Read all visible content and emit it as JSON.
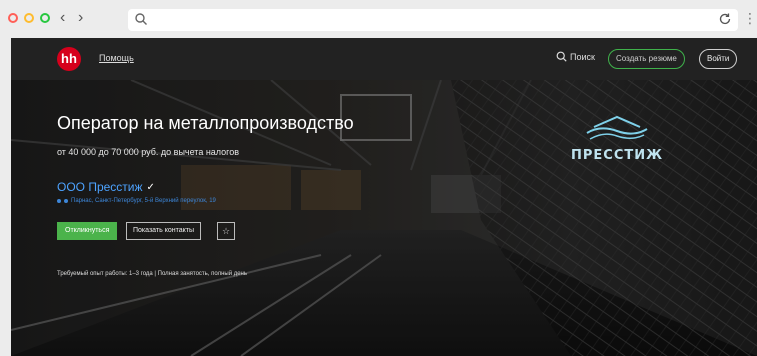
{
  "browser": {
    "address_value": "",
    "icons": [
      "search-icon",
      "reload-icon",
      "back-icon",
      "forward-icon"
    ]
  },
  "header": {
    "logo_text": "hh",
    "help_link": "Помощь",
    "search_label": "Поиск",
    "create_resume_label": "Создать резюме",
    "login_label": "Войти"
  },
  "vacancy": {
    "title": "Оператор на металлопроизводство",
    "salary": "от 40 000 до 70 000 руб. до вычета налогов",
    "company": "ООО Пресстиж",
    "address": "Парнас, Санкт-Петербург, 5-й Верхний переулок, 19",
    "respond_label": "Откликнуться",
    "show_contacts_label": "Показать контакты",
    "experience": "Требуемый опыт работы: 1–3 года | Полная занятость, полный день"
  },
  "brand": {
    "name": "ПРЕССТИЖ"
  },
  "colors": {
    "accent_green": "#4bb34b",
    "link_blue": "#4da3ff",
    "logo_red": "#d6001c"
  }
}
